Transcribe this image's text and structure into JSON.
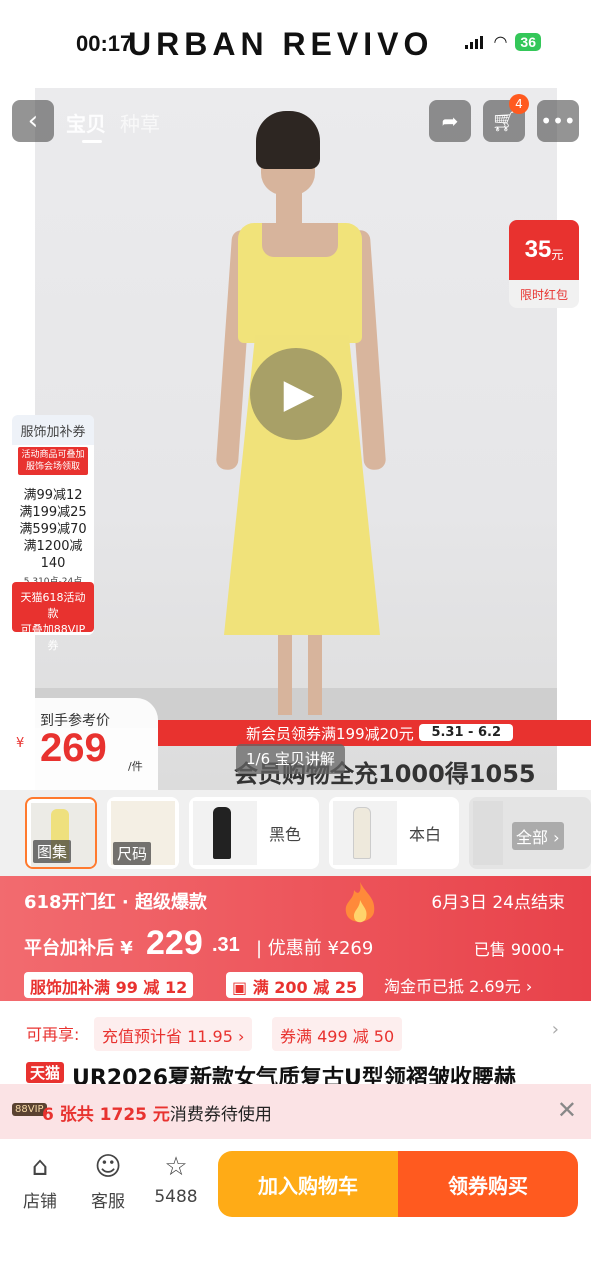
{
  "status_bar": {
    "time": "00:17",
    "brand": "URBAN REVIVO",
    "battery": "36"
  },
  "topbar": {
    "tabs": [
      "宝贝",
      "种草"
    ],
    "cart_count": "4"
  },
  "hero": {
    "red_packet": {
      "amount": "35",
      "unit": "元",
      "label": "限时红包"
    },
    "coupon_card": {
      "title": "服饰加补券",
      "note": "活动商品可叠加服饰会场领取",
      "rules": [
        "满99减12",
        "满199减25",
        "满599减70",
        "满1200减140"
      ],
      "date": "5.310点-24点"
    },
    "vip_card": {
      "line1": "天猫618活动款",
      "line2": "可叠加88VIP券"
    },
    "ref_price": {
      "label": "到手参考价",
      "currency": "¥",
      "value": "269",
      "unit": "/件"
    },
    "promo": {
      "text": "新会员领券满199减20元",
      "date": "5.31 - 6.2"
    },
    "video_tag": "1/6 宝贝讲解",
    "recharge": "会员购物全充1000得1055"
  },
  "thumbnails": [
    {
      "label": "图集"
    },
    {
      "label": "尺码"
    },
    {
      "label": "黑色"
    },
    {
      "label": "本白"
    },
    {
      "label": "全部"
    }
  ],
  "banner": {
    "title": "618开门红 · 超级爆款",
    "end": "6月3日 24点结束",
    "price_label": "平台加补后",
    "currency": "¥",
    "price_int": "229",
    "price_dec": ".31",
    "before": "| 优惠前 ¥269",
    "sold": "已售 9000+",
    "chip1": "服饰加补满 99 减 12",
    "chip2": "满 200 减 25",
    "tao": "淘金币已抵 2.69元"
  },
  "benefits": {
    "label": "可再享:",
    "chip1": "充值预计省 11.95",
    "chip2": "券满 499 减 50"
  },
  "title": {
    "tag": "天猫",
    "text": "UR2026夏新款女气质复古U型领褶皱收腰赫"
  },
  "voucher": {
    "badge": "88VIP",
    "highlight": "6 张共 1725 元",
    "tail": "消费券待使用"
  },
  "bottom": {
    "shop": "店铺",
    "service": "客服",
    "fav": "5488",
    "cart": "加入购物车",
    "buy": "领券购买"
  },
  "colors": {
    "accent": "#e8322f",
    "cart_button": "#ffab16",
    "buy_button": "#ff5a1f"
  }
}
